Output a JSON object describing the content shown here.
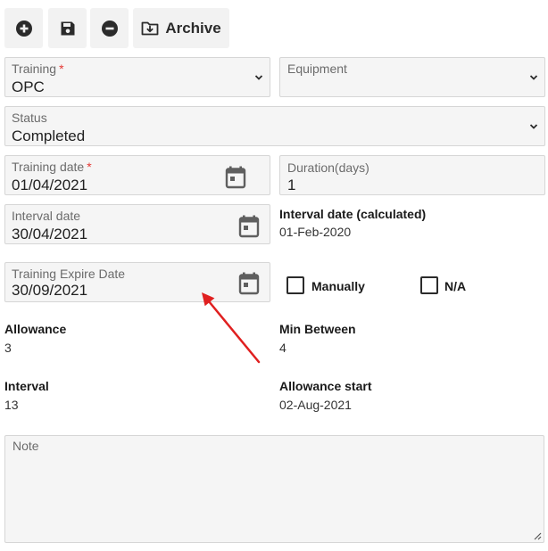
{
  "toolbar": {
    "archive_label": "Archive"
  },
  "form": {
    "training": {
      "label": "Training",
      "required_mark": "*",
      "value": "OPC"
    },
    "equipment": {
      "label": "Equipment",
      "value": ""
    },
    "status": {
      "label": "Status",
      "value": "Completed"
    },
    "training_date": {
      "label": "Training date",
      "required_mark": "*",
      "value": "01/04/2021"
    },
    "duration": {
      "label": "Duration(days)",
      "value": "1"
    },
    "interval_date": {
      "label": "Interval date",
      "value": "30/04/2021"
    },
    "interval_date_calculated": {
      "label": "Interval date (calculated)",
      "value": "01-Feb-2020"
    },
    "training_expire_date": {
      "label": "Training Expire Date",
      "value": "30/09/2021"
    },
    "manually": {
      "label": "Manually",
      "checked": false
    },
    "na": {
      "label": "N/A",
      "checked": false
    },
    "allowance": {
      "label": "Allowance",
      "value": "3"
    },
    "min_between": {
      "label": "Min Between",
      "value": "4"
    },
    "interval": {
      "label": "Interval",
      "value": "13"
    },
    "allowance_start": {
      "label": "Allowance start",
      "value": "02-Aug-2021"
    },
    "note": {
      "label": "Note",
      "value": ""
    }
  },
  "colors": {
    "required": "#e53935",
    "annotation_arrow": "#e02020",
    "field_bg": "#f5f5f5",
    "toolbar_bg": "#f2f2f2"
  },
  "icons": {
    "add": "plus-circle-icon",
    "save": "floppy-disk-icon",
    "remove": "minus-circle-icon",
    "archive": "folder-download-icon",
    "dropdown": "chevron-down-icon",
    "date": "calendar-icon"
  }
}
